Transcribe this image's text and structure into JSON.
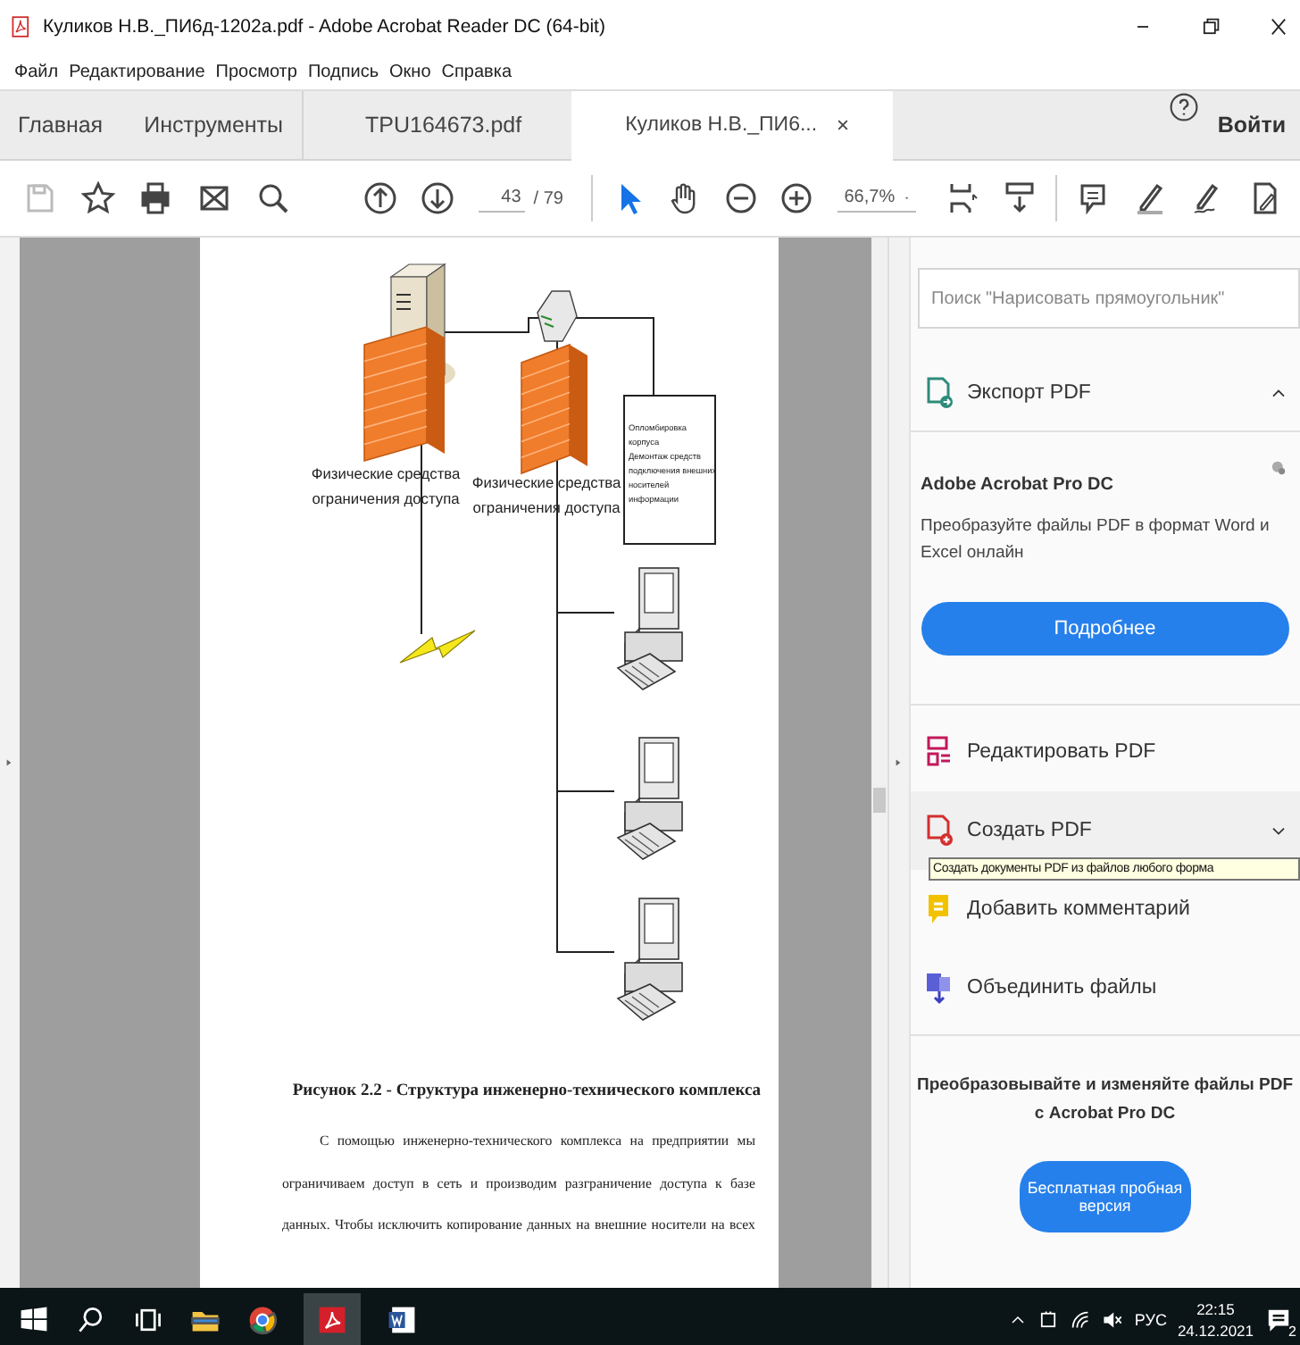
{
  "window": {
    "title": "Куликов Н.В._ПИ6д-1202a.pdf - Adobe Acrobat Reader DC (64-bit)"
  },
  "menu": [
    "Файл",
    "Редактирование",
    "Просмотр",
    "Подпись",
    "Окно",
    "Справка"
  ],
  "tabs": [
    {
      "label": "Главная",
      "selected": false
    },
    {
      "label": "Инструменты",
      "selected": false
    },
    {
      "label": "TPU164673.pdf",
      "selected": false
    },
    {
      "label": "Куликов Н.В._ПИ6...",
      "selected": true
    }
  ],
  "sign_in": "Войти",
  "toolbar": {
    "page": "43",
    "page_total": "/ 79",
    "zoom": "66,7%"
  },
  "document": {
    "labels": [
      {
        "lines": [
          "Физические средства",
          "ограничения доступа"
        ]
      },
      {
        "lines": [
          "Физические средства",
          "ограничения доступа"
        ]
      }
    ],
    "note": [
      "Опломбировка",
      "корпуса",
      "Демонтаж средств",
      "подключения внешних",
      "носителей",
      "информации"
    ],
    "caption": "Рисунок 2.2 - Структура инженерно-технического комплекса",
    "paragraph": [
      "С помощью инженерно-технического комплекса на предприятии мы",
      "ограничиваем доступ в сеть и производим разграничение доступа к базе",
      "данных. Чтобы исключить копирование данных на внешние носители на всех"
    ]
  },
  "panel": {
    "search": {
      "placeholder": "Поиск \"Нарисовать прямоугольник\""
    },
    "export": {
      "label": "Экспорт PDF",
      "expanded": true,
      "title": "Adobe Acrobat Pro DC",
      "text": "Преобразуйте файлы PDF в формат Word и Excel онлайн",
      "button": "Подробнее"
    },
    "tools": [
      {
        "kind": "edit",
        "label": "Редактировать PDF",
        "hovered": false
      },
      {
        "kind": "create",
        "label": "Создать PDF",
        "hovered": true
      },
      {
        "kind": "comment",
        "label": "Добавить комментарий",
        "hovered": false
      },
      {
        "kind": "combine",
        "label": "Объединить файлы",
        "hovered": false
      }
    ],
    "tooltip": "Создать документы PDF из файлов любого форма",
    "promo": {
      "lines": [
        "Преобразовывайте и изменяйте файлы PDF",
        "с Acrobat Pro DC"
      ],
      "button": "Бесплатная пробная версия"
    }
  },
  "taskbar": {
    "language": "РУС",
    "time": "22:15",
    "date": "24.12.2021",
    "notifications": "2"
  }
}
